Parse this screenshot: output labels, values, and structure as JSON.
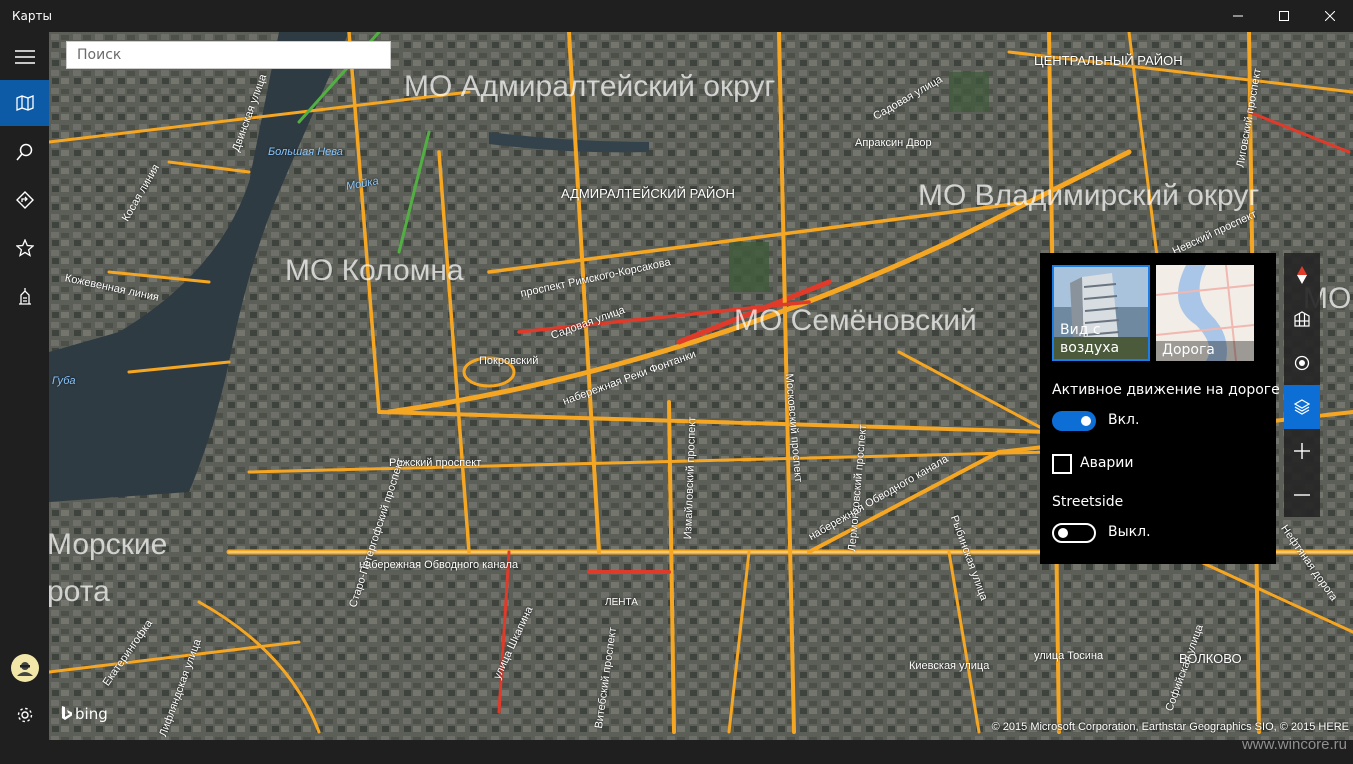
{
  "window": {
    "title": "Карты",
    "controls": [
      "minimize-icon",
      "maximize-icon",
      "close-icon"
    ]
  },
  "nav": {
    "items": [
      {
        "icon": "hamburger-icon"
      },
      {
        "icon": "map-icon",
        "active": true
      },
      {
        "icon": "search-icon"
      },
      {
        "icon": "directions-icon"
      },
      {
        "icon": "star-icon"
      },
      {
        "icon": "city-tour-icon"
      }
    ],
    "bottom": [
      {
        "icon": "avatar-icon"
      },
      {
        "icon": "gear-icon"
      }
    ]
  },
  "search": {
    "placeholder": "Поиск"
  },
  "map": {
    "districts": [
      "МО Адмиралтейский округ",
      "МО Коломна",
      "МО Семёновский",
      "МО Владимирский округ",
      "Морские",
      "рота",
      "МО"
    ],
    "wards": [
      "АДМИРАЛТЕЙСКИЙ РАЙОН",
      "ЦЕНТРАЛЬНЫЙ РАЙОН",
      "ВОЛКОВО",
      "ЛЕНТА",
      "Покровский"
    ],
    "streets": [
      "проспект Римского-Корсакова",
      "набережная Реки Фонтанки",
      "Садовая улица",
      "Рижский проспект",
      "набережная Обводного канала",
      "Измайловский проспект",
      "Московский проспект",
      "Лиговский проспект",
      "Садовая улица",
      "Невский проспект",
      "Кожевенная линия",
      "Косая линия",
      "Двинская улица",
      "Старо-Петергофский проспект",
      "Лермонтовский проспект",
      "Киевская улица",
      "улица Тосина",
      "набережная Обводного канала",
      "Рыбинская улица",
      "Екатерингофка",
      "Лифляндская улица",
      "улица Шкапина",
      "Нефтяная дорога",
      "Витебский проспект",
      "Апраксин Двор",
      "Софийская улица"
    ],
    "water": [
      "Большая Нева",
      "Мойка",
      "Губа"
    ]
  },
  "layers": {
    "aerial_label": "Вид с воздуха",
    "road_label": "Дорога",
    "traffic_label": "Активное движение на дороге",
    "traffic_state": "Вкл.",
    "traffic_on": true,
    "incidents_label": "Аварии",
    "incidents_checked": false,
    "streetside_label": "Streetside",
    "streetside_state": "Выкл.",
    "streetside_on": false
  },
  "map_controls": [
    "compass-icon",
    "3d-cities-icon",
    "my-location-icon",
    "layers-icon",
    "zoom-in-icon",
    "zoom-out-icon"
  ],
  "footer": {
    "bing": "bing",
    "copyright": "© 2015 Microsoft Corporation, Earthstar Geographics SIO, © 2015 HERE",
    "watermark": "www.wincore.ru"
  },
  "colors": {
    "accent": "#0d6fd6",
    "nav_active": "#0d5aa7",
    "traffic_fast": "#f5a623",
    "traffic_slow": "#e03b2a",
    "traffic_free": "#52b043"
  }
}
